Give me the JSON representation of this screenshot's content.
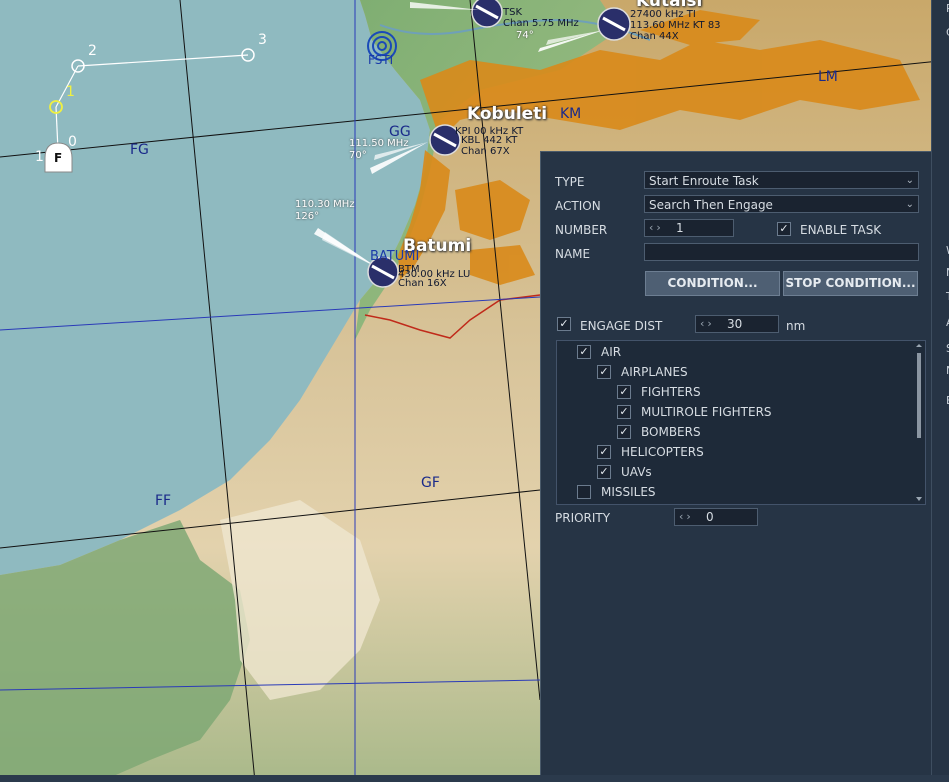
{
  "map": {
    "grid_labels": [
      "FG",
      "KM",
      "LM",
      "GG",
      "FF",
      "GF"
    ],
    "cities": [
      "Kobuleti",
      "Batumi",
      "Kutaisi"
    ],
    "beacon_label": "FSTI",
    "batumi_beacon_label": "BATUMI",
    "batumi_tacan_freq": "110.30 MHz",
    "batumi_tacan_heading": "126°",
    "kobuleti_freq": "111.50 MHz",
    "kobuleti_heading": "70°",
    "kobuleti_nav_1": "KPI 00 kHz KT",
    "kobuleti_nav_2": "KBL 442 KT",
    "kobuleti_chan": "Chan 67X",
    "batumi_nav_1": "BTM",
    "batumi_nav_2": "430.00 kHz LU",
    "batumi_chan": "Chan 16X",
    "kutaisi_nav_1": "TSK",
    "kutaisi_nav_2": "Chan 5.75 MHz",
    "kutaisi_heading": "74°",
    "kutaisi_nav_3": "27400 kHz TI",
    "kutaisi_nav_4": "113.60 MHz KT 83",
    "kutaisi_chan": "Chan 44X",
    "waypoints": [
      "0",
      "1",
      "2",
      "3"
    ],
    "flight_marker": "F",
    "flight_marker_num": "1"
  },
  "panel": {
    "type_label": "TYPE",
    "type_value": "Start Enroute Task",
    "action_label": "ACTION",
    "action_value": "Search Then Engage",
    "number_label": "NUMBER",
    "number_value": "1",
    "enable_task_label": "ENABLE TASK",
    "enable_task_checked": true,
    "name_label": "NAME",
    "name_value": "",
    "condition_button": "CONDITION...",
    "stop_condition_button": "STOP CONDITION...",
    "engage_dist_label": "ENGAGE DIST",
    "engage_dist_value": "30",
    "engage_dist_unit": "nm",
    "engage_dist_checked": true,
    "targets": [
      {
        "label": "AIR",
        "checked": true,
        "level": 1
      },
      {
        "label": "AIRPLANES",
        "checked": true,
        "level": 2
      },
      {
        "label": "FIGHTERS",
        "checked": true,
        "level": 3
      },
      {
        "label": "MULTIROLE FIGHTERS",
        "checked": true,
        "level": 3
      },
      {
        "label": "BOMBERS",
        "checked": true,
        "level": 3
      },
      {
        "label": "HELICOPTERS",
        "checked": true,
        "level": 2
      },
      {
        "label": "UAVs",
        "checked": true,
        "level": 2
      },
      {
        "label": "MISSILES",
        "checked": false,
        "level": 1
      }
    ],
    "priority_label": "PRIORITY",
    "priority_value": "0"
  },
  "right_strip_letters": [
    "R",
    "C",
    "W",
    "N",
    "T",
    "A",
    "S",
    "N",
    "E"
  ],
  "colors": {
    "panel_bg": "#263445",
    "sea": "#8fbac0",
    "accent": "#f0f040"
  }
}
